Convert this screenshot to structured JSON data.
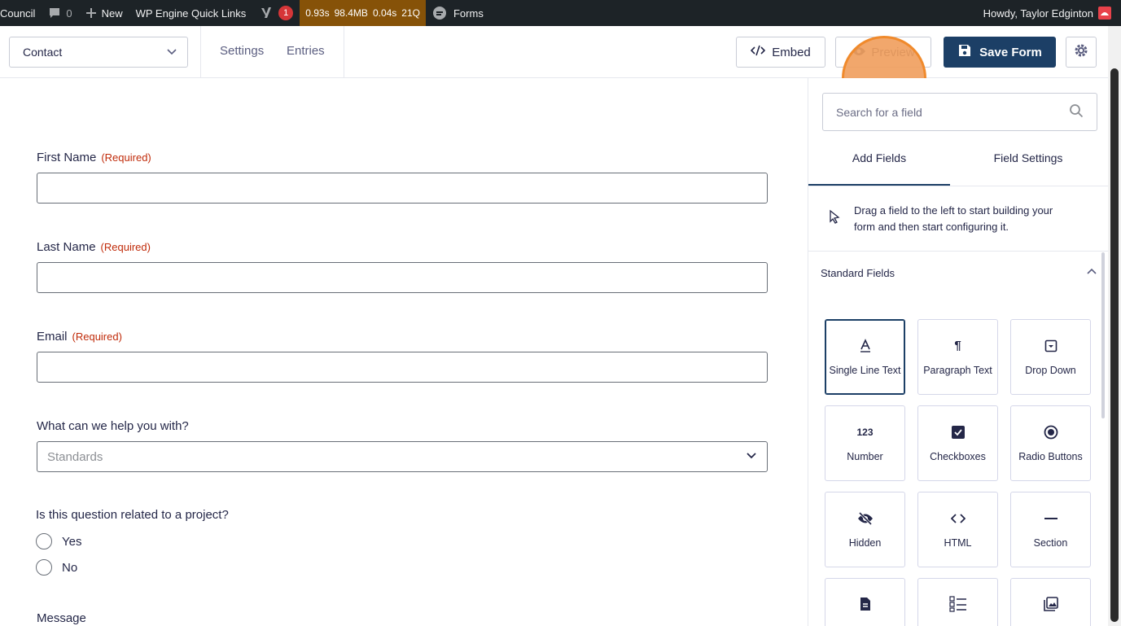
{
  "adminbar": {
    "site_name": "Council",
    "comments_count": "0",
    "new_label": "New",
    "quick_links": "WP Engine Quick Links",
    "yoast_badge": "1",
    "perf_time": "0.93s",
    "perf_memory": "98.4MB",
    "perf_db_time": "0.04s",
    "perf_queries": "21Q",
    "forms_label": "Forms",
    "greeting": "Howdy, Taylor Edginton"
  },
  "toolbar": {
    "form_name": "Contact",
    "settings_label": "Settings",
    "entries_label": "Entries",
    "embed_label": "Embed",
    "preview_label": "Preview",
    "save_label": "Save Form"
  },
  "form": {
    "required_text": "(Required)",
    "first_name_label": "First Name",
    "last_name_label": "Last Name",
    "email_label": "Email",
    "help_label": "What can we help you with?",
    "help_selected": "Standards",
    "project_question": "Is this question related to a project?",
    "radio_yes": "Yes",
    "radio_no": "No",
    "message_label": "Message"
  },
  "sidebar": {
    "search_placeholder": "Search for a field",
    "tab_add": "Add Fields",
    "tab_settings": "Field Settings",
    "help_text_line1": "Drag a field to the left to start building your",
    "help_text_line2": "form and then start configuring it.",
    "section_title": "Standard Fields",
    "tiles": [
      {
        "label": "Single Line Text",
        "icon": "text-a-icon"
      },
      {
        "label": "Paragraph Text",
        "icon": "pilcrow-icon"
      },
      {
        "label": "Drop Down",
        "icon": "dropdown-box-icon"
      },
      {
        "label": "Number",
        "icon": "123-icon"
      },
      {
        "label": "Checkboxes",
        "icon": "checkbox-icon"
      },
      {
        "label": "Radio Buttons",
        "icon": "radio-icon"
      },
      {
        "label": "Hidden",
        "icon": "eye-slash-icon"
      },
      {
        "label": "HTML",
        "icon": "code-icon"
      },
      {
        "label": "Section",
        "icon": "dash-icon"
      }
    ]
  },
  "colors": {
    "primary": "#1c3f66",
    "required": "#c02b0a",
    "highlight": "#f08a2c",
    "adminbar": "#1d2327",
    "perf_bg": "#865208"
  }
}
